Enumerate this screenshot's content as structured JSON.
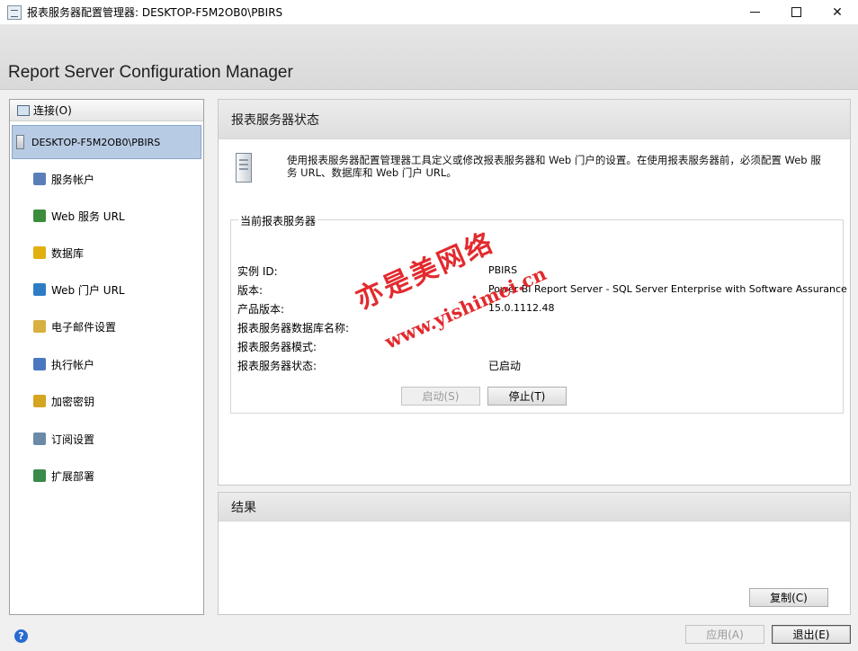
{
  "window": {
    "title": "报表服务器配置管理器: DESKTOP-F5M2OB0\\PBIRS",
    "minimize": "—",
    "maximize": "☐",
    "close": "✕"
  },
  "banner": {
    "title": "Report Server Configuration Manager"
  },
  "nav": {
    "connect_label": "连接(O)",
    "server_label": "DESKTOP-F5M2OB0\\PBIRS",
    "items": [
      {
        "label": "服务帐户",
        "icon": "service-account-icon",
        "color": "#5a7fb8"
      },
      {
        "label": "Web 服务 URL",
        "icon": "web-service-icon",
        "color": "#3c8c3c"
      },
      {
        "label": "数据库",
        "icon": "database-icon",
        "color": "#e0b010"
      },
      {
        "label": "Web 门户 URL",
        "icon": "globe-icon",
        "color": "#2e7cc4"
      },
      {
        "label": "电子邮件设置",
        "icon": "email-icon",
        "color": "#d8b040"
      },
      {
        "label": "执行帐户",
        "icon": "execution-account-icon",
        "color": "#4a78c0"
      },
      {
        "label": "加密密钥",
        "icon": "key-icon",
        "color": "#d4a520"
      },
      {
        "label": "订阅设置",
        "icon": "subscription-icon",
        "color": "#6a8aa8"
      },
      {
        "label": "扩展部署",
        "icon": "scale-out-icon",
        "color": "#3a8a4a"
      }
    ]
  },
  "status_panel": {
    "heading": "报表服务器状态",
    "description": "使用报表服务器配置管理器工具定义或修改报表服务器和 Web 门户的设置。在使用报表服务器前，必须配置 Web 服务 URL、数据库和 Web 门户 URL。",
    "group_label": "当前报表服务器",
    "rows": [
      {
        "label": "实例 ID:",
        "value": "PBIRS"
      },
      {
        "label": "版本:",
        "value": "Power BI Report Server - SQL Server Enterprise with Software Assurance"
      },
      {
        "label": "产品版本:",
        "value": "15.0.1112.48"
      },
      {
        "label": "报表服务器数据库名称:",
        "value": ""
      },
      {
        "label": "报表服务器模式:",
        "value": ""
      },
      {
        "label": "报表服务器状态:",
        "value": "已启动"
      }
    ],
    "start_button": "启动(S)",
    "stop_button": "停止(T)"
  },
  "result_panel": {
    "heading": "结果",
    "copy_button": "复制(C)"
  },
  "footer": {
    "apply_button": "应用(A)",
    "exit_button": "退出(E)",
    "help_icon": "?"
  },
  "watermark": {
    "cn": "亦是美网络",
    "url": "www.yishimei.cn",
    "color": "#e0191d"
  }
}
